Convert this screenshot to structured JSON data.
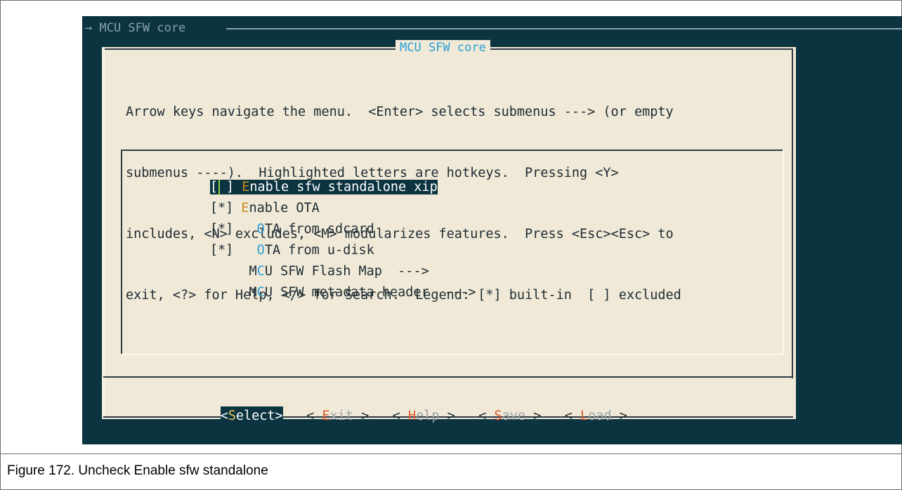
{
  "terminal": {
    "title": "→ MCU SFW core"
  },
  "dialog": {
    "title": "MCU SFW core",
    "help_lines": [
      "Arrow keys navigate the menu.  <Enter> selects submenus ---> (or empty",
      "submenus ----).  Highlighted letters are hotkeys.  Pressing <Y>",
      "includes, <N> excludes, <M> modularizes features.  Press <Esc><Esc> to",
      "exit, <?> for Help, </> for Search.  Legend: [*] built-in  [ ] excluded"
    ],
    "menu_items": [
      {
        "checkbox": "[ ]",
        "hotkey": "E",
        "rest": "nable sfw standalone xip",
        "selected": true
      },
      {
        "checkbox": "[*]",
        "hotkey": "E",
        "rest": "nable OTA",
        "selected": false
      },
      {
        "checkbox": "[*]",
        "prefix": "  ",
        "hotkey": "O",
        "rest": "TA from sdcard",
        "selected": false
      },
      {
        "checkbox": "[*]",
        "prefix": "  ",
        "hotkey": "O",
        "rest": "TA from u-disk",
        "selected": false
      },
      {
        "checkbox": "",
        "prefix": "    ",
        "hotkey_pre": "M",
        "hotkey": "C",
        "rest": "U SFW Flash Map  --->",
        "selected": false
      },
      {
        "checkbox": "",
        "prefix": "    ",
        "hotkey_pre": "M",
        "hotkey": "C",
        "rest": "U SFW metadata header  --->",
        "selected": false
      }
    ],
    "buttons": [
      {
        "open": "<",
        "hotkey": "S",
        "rest": "elect",
        "close": ">",
        "active": true
      },
      {
        "open": "< ",
        "hotkey": "E",
        "rest": "xit",
        "close": " >",
        "active": false
      },
      {
        "open": "< ",
        "hotkey": "H",
        "rest": "elp",
        "close": " >",
        "active": false
      },
      {
        "open": "< ",
        "hotkey": "S",
        "rest": "ave",
        "close": " >",
        "active": false
      },
      {
        "open": "< ",
        "hotkey": "L",
        "rest": "oad",
        "close": " >",
        "active": false
      }
    ]
  },
  "caption": "Figure 172. Uncheck Enable sfw standalone",
  "colors": {
    "terminal_bg": "#0c3440",
    "dialog_bg": "#f0e9d7",
    "hotkey": "#c98a1e",
    "title_blue": "#2a9fd6",
    "button_hotkey": "#e05a2e"
  }
}
